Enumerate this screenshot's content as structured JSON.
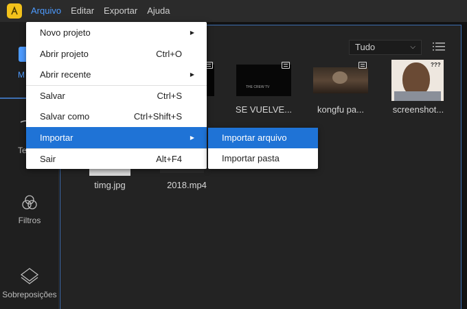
{
  "menubar": {
    "items": [
      "Arquivo",
      "Editar",
      "Exportar",
      "Ajuda"
    ]
  },
  "sidebar": {
    "items": [
      "M",
      "Te",
      "Filtros",
      "Sobreposições"
    ]
  },
  "toolbar": {
    "filter_value": "Tudo"
  },
  "media": [
    {
      "label": "SE VUELVE...",
      "overlay_text": "THE CREW TV"
    },
    {
      "label": "kongfu pa..."
    },
    {
      "label": "screenshot...",
      "overlay_text": "???"
    },
    {
      "label": "timg.jpg"
    },
    {
      "label": "2018.mp4"
    }
  ],
  "file_menu": {
    "items": [
      {
        "label": "Novo projeto",
        "shortcut": ""
      },
      {
        "label": "Abrir projeto",
        "shortcut": "Ctrl+O"
      },
      {
        "label": "Abrir recente",
        "shortcut": ""
      },
      {
        "label": "Salvar",
        "shortcut": "Ctrl+S"
      },
      {
        "label": "Salvar como",
        "shortcut": "Ctrl+Shift+S"
      },
      {
        "label": "Importar",
        "shortcut": ""
      },
      {
        "label": "Sair",
        "shortcut": "Alt+F4"
      }
    ]
  },
  "import_submenu": {
    "items": [
      "Importar arquivo",
      "Importar pasta"
    ]
  },
  "colors": {
    "accent": "#1f73d6",
    "menu_active": "#4d9bff",
    "logo": "#f3c21b"
  }
}
